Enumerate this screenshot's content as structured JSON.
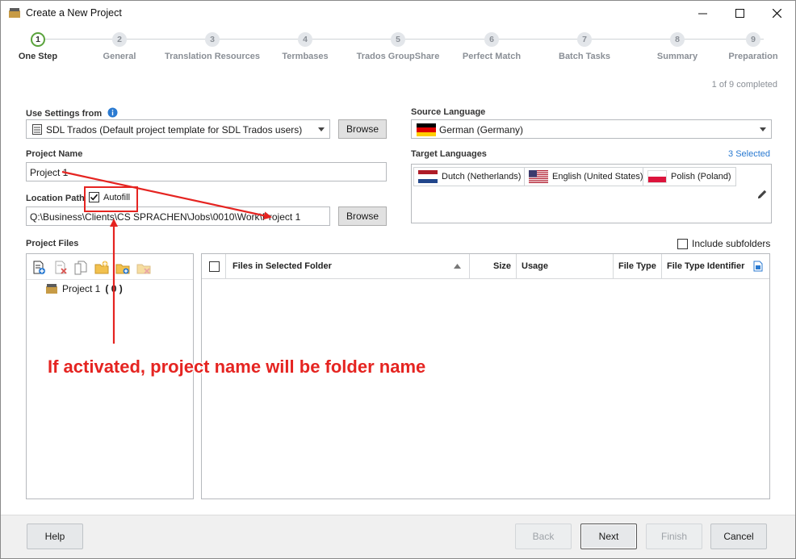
{
  "window": {
    "title": "Create a New Project"
  },
  "steps": [
    {
      "num": "1",
      "label": "One Step"
    },
    {
      "num": "2",
      "label": "General"
    },
    {
      "num": "3",
      "label": "Translation Resources"
    },
    {
      "num": "4",
      "label": "Termbases"
    },
    {
      "num": "5",
      "label": "Trados GroupShare"
    },
    {
      "num": "6",
      "label": "Perfect Match"
    },
    {
      "num": "7",
      "label": "Batch Tasks"
    },
    {
      "num": "8",
      "label": "Summary"
    },
    {
      "num": "9",
      "label": "Preparation"
    }
  ],
  "progress": "1 of 9 completed",
  "use_settings": {
    "label": "Use Settings from",
    "value": "SDL Trados (Default project template for SDL Trados users)",
    "browse": "Browse"
  },
  "project_name": {
    "label": "Project Name",
    "value": "Project 1"
  },
  "location": {
    "label": "Location Path",
    "autofill_label": "Autofill",
    "autofill_checked": true,
    "value": "Q:\\Business\\Clients\\CS SPRACHEN\\Jobs\\0010\\Work\\Project 1",
    "browse": "Browse"
  },
  "source_language": {
    "label": "Source Language",
    "value": "German (Germany)"
  },
  "target_languages": {
    "label": "Target Languages",
    "selected_count": "3 Selected",
    "items": [
      "Dutch (Netherlands)",
      "English (United States)",
      "Polish (Poland)"
    ]
  },
  "project_files": {
    "label": "Project Files",
    "include_subfolders": "Include subfolders",
    "tree_root": "Project 1",
    "tree_count": "( 0 )",
    "columns": [
      "Files in Selected Folder",
      "Size",
      "Usage",
      "File Type",
      "File Type Identifier"
    ]
  },
  "annotation": {
    "text": "If activated, project name will be folder name",
    "color": "#e52421"
  },
  "footer": {
    "help": "Help",
    "back": "Back",
    "next": "Next",
    "finish": "Finish",
    "cancel": "Cancel"
  }
}
